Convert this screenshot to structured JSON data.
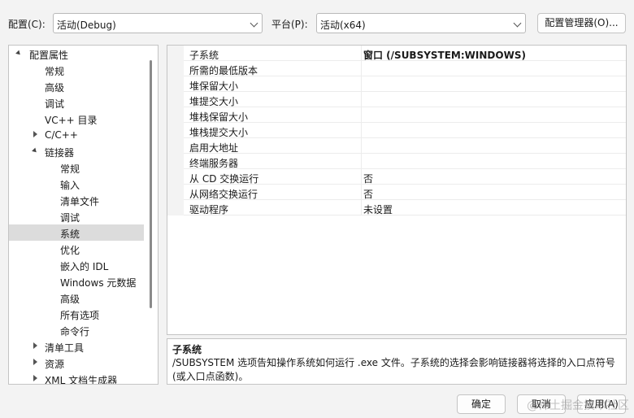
{
  "toolbar": {
    "config_label": "配置(C):",
    "config_value": "活动(Debug)",
    "platform_label": "平台(P):",
    "platform_value": "活动(x64)",
    "config_manager_label": "配置管理器(O)..."
  },
  "tree": {
    "items": [
      {
        "label": "配置属性"
      },
      {
        "label": "常规"
      },
      {
        "label": "高级"
      },
      {
        "label": "调试"
      },
      {
        "label": "VC++ 目录"
      },
      {
        "label": "C/C++"
      },
      {
        "label": "链接器"
      },
      {
        "label": "常规"
      },
      {
        "label": "输入"
      },
      {
        "label": "清单文件"
      },
      {
        "label": "调试"
      },
      {
        "label": "系统"
      },
      {
        "label": "优化"
      },
      {
        "label": "嵌入的 IDL"
      },
      {
        "label": "Windows 元数据"
      },
      {
        "label": "高级"
      },
      {
        "label": "所有选项"
      },
      {
        "label": "命令行"
      },
      {
        "label": "清单工具"
      },
      {
        "label": "资源"
      },
      {
        "label": "XML 文档生成器"
      }
    ]
  },
  "properties": [
    {
      "name": "子系统",
      "value": "窗口 (/SUBSYSTEM:WINDOWS)"
    },
    {
      "name": "所需的最低版本",
      "value": ""
    },
    {
      "name": "堆保留大小",
      "value": ""
    },
    {
      "name": "堆提交大小",
      "value": ""
    },
    {
      "name": "堆栈保留大小",
      "value": ""
    },
    {
      "name": "堆栈提交大小",
      "value": ""
    },
    {
      "name": "启用大地址",
      "value": ""
    },
    {
      "name": "终端服务器",
      "value": ""
    },
    {
      "name": "从 CD 交换运行",
      "value": "否"
    },
    {
      "name": "从网络交换运行",
      "value": "否"
    },
    {
      "name": "驱动程序",
      "value": "未设置"
    }
  ],
  "description": {
    "title": "子系统",
    "text": "/SUBSYSTEM 选项告知操作系统如何运行 .exe 文件。子系统的选择会影响链接器将选择的入口点符号(或入口点函数)。"
  },
  "buttons": {
    "ok": "确定",
    "cancel": "取消",
    "apply": "应用(A)"
  },
  "watermark": "@稀土掘金技术社区"
}
